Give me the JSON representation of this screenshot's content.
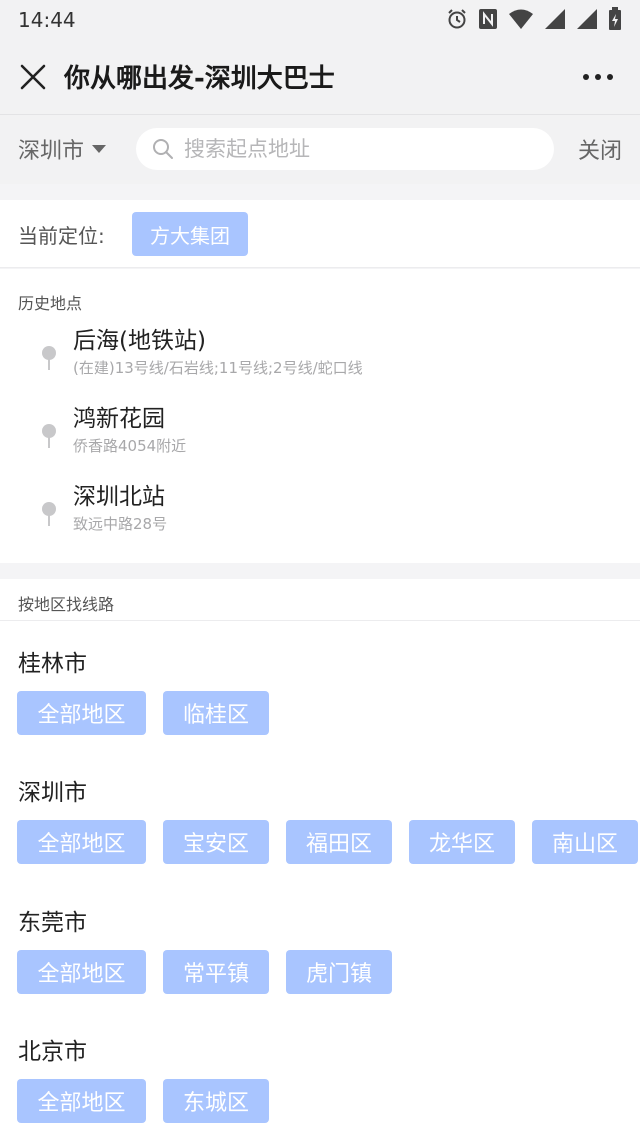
{
  "status_bar": {
    "time": "14:44",
    "icons": [
      "alarm-icon",
      "nfc-icon",
      "wifi-icon",
      "signal-icon",
      "signal-icon",
      "battery-icon"
    ]
  },
  "header": {
    "title": "你从哪出发-深圳大巴士",
    "close_icon": "close-icon",
    "more_icon": "more-icon"
  },
  "search": {
    "city": "深圳市",
    "placeholder": "搜索起点地址",
    "value": "",
    "close_label": "关闭"
  },
  "current_location": {
    "label": "当前定位:",
    "value": "方大集团"
  },
  "history": {
    "title": "历史地点",
    "items": [
      {
        "name": "后海(地铁站)",
        "address": "(在建)13号线/石岩线;11号线;2号线/蛇口线"
      },
      {
        "name": "鸿新花园",
        "address": "侨香路4054附近"
      },
      {
        "name": "深圳北站",
        "address": "致远中路28号"
      }
    ]
  },
  "regions": {
    "title": "按地区找线路",
    "groups": [
      {
        "city": "桂林市",
        "districts": [
          "全部地区",
          "临桂区"
        ]
      },
      {
        "city": "深圳市",
        "districts": [
          "全部地区",
          "宝安区",
          "福田区",
          "龙华区",
          "南山区"
        ]
      },
      {
        "city": "东莞市",
        "districts": [
          "全部地区",
          "常平镇",
          "虎门镇"
        ]
      },
      {
        "city": "北京市",
        "districts": [
          "全部地区",
          "东城区"
        ]
      }
    ]
  },
  "colors": {
    "chip_bg": "#a9c5ff",
    "chip_text": "#ffffff",
    "header_bg": "#f2f2f3",
    "page_bg": "#f4f4f6"
  }
}
